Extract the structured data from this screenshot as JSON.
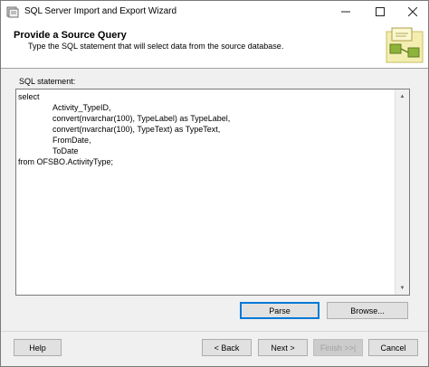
{
  "window": {
    "title": "SQL Server Import and Export Wizard",
    "icon": "wizard-app-icon"
  },
  "header": {
    "title": "Provide a Source Query",
    "subtitle": "Type the SQL statement that will select data from the source database."
  },
  "editor": {
    "label": "SQL statement:",
    "lines": [
      {
        "text": "select",
        "indent": false
      },
      {
        "text": "Activity_TypeID,",
        "indent": true
      },
      {
        "text": "convert(nvarchar(100), TypeLabel) as TypeLabel,",
        "indent": true
      },
      {
        "text": "convert(nvarchar(100), TypeText) as TypeText,",
        "indent": true
      },
      {
        "text": "FromDate,",
        "indent": true
      },
      {
        "text": "ToDate",
        "indent": true
      },
      {
        "text": "from OFSBO.ActivityType;",
        "indent": false
      }
    ]
  },
  "buttons": {
    "parse": "Parse",
    "browse": "Browse...",
    "help": "Help",
    "back": "< Back",
    "next": "Next >",
    "finish": "Finish >>|",
    "cancel": "Cancel"
  },
  "colors": {
    "accent": "#0078d7",
    "titlebar": "#ffffff",
    "dialog": "#f0f0f0"
  }
}
